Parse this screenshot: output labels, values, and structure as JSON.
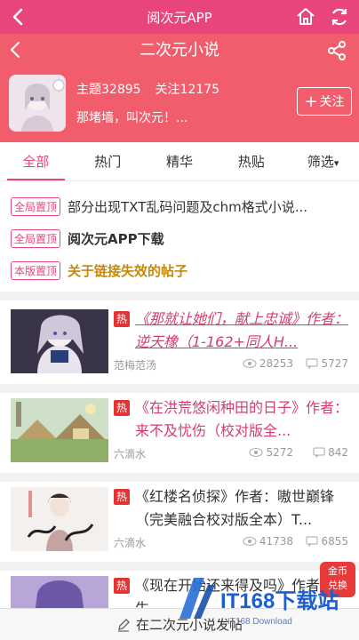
{
  "app_bar": {
    "title": "阅次元APP"
  },
  "forum": {
    "name": "二次元小说",
    "topics_label": "主题32895",
    "followers_label": "关注12175",
    "motto": "那堵墙，叫次元！...",
    "follow_label": "关注",
    "follow_plus": "+"
  },
  "tabs": [
    "全部",
    "热门",
    "精华",
    "热贴",
    "筛选"
  ],
  "tab_dropdown_mark": "▾",
  "pinned": [
    {
      "badge": "全局置顶",
      "text": "部分出现TXT乱码问题及chm格式小说..."
    },
    {
      "badge": "全局置顶",
      "text": "阅次元APP下载"
    },
    {
      "badge": "本版置顶",
      "text": "关于链接失效的帖子"
    }
  ],
  "posts": [
    {
      "hot": "热",
      "title": "《那就让她们，献上忠诚》作者：逆天橡（1-162+同人H...",
      "author": "范梅范汤",
      "views": "28253",
      "replies": "5727"
    },
    {
      "hot": "热",
      "title": "《在洪荒悠闲种田的日子》作者：来不及忧伤（校对版全...",
      "author": "六滴水",
      "views": "5272",
      "replies": "842"
    },
    {
      "hot": "热",
      "title": "《红楼名侦探》作者：嗷世巅锋（完美融合校对版全本）T...",
      "author": "六滴水",
      "views": "41738",
      "replies": "6855"
    },
    {
      "hot": "热",
      "title": "《现在开始还来得及吗》作者：泼生",
      "author": "",
      "views": "",
      "replies": ""
    }
  ],
  "bottom_bar": {
    "label": "在二次元小说发帖"
  },
  "coin_badge": {
    "line1": "金币",
    "line2": "兑换"
  },
  "watermark": {
    "brand": "IT168下载站",
    "sub": "IT168 Download"
  },
  "colors": {
    "accent": "#e8457a",
    "header": "#f25d6d",
    "hot": "#e53232",
    "gold": "#c5880c"
  }
}
